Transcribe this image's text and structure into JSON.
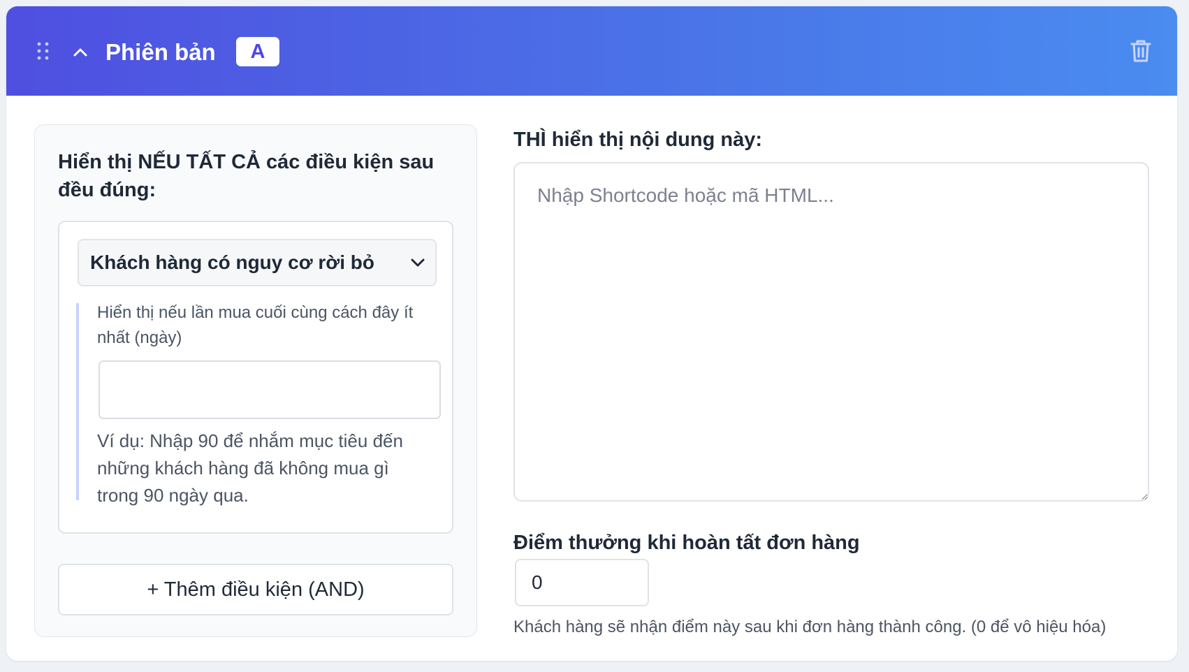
{
  "header": {
    "title": "Phiên bản",
    "badge": "A",
    "colors": {
      "gradient_start": "#4f4fe0",
      "gradient_end": "#4a8cf0"
    },
    "icons": [
      "drag-handle-icon",
      "chevron-up-icon",
      "trash-icon"
    ]
  },
  "conditions": {
    "title": "Hiển thị NẾU TẤT CẢ các điều kiện sau đều đúng:",
    "selected_condition": "Khách hàng có nguy cơ rời bỏ",
    "days_label": "Hiển thị nếu lần mua cuối cùng cách đây ít nhất (ngày)",
    "days_value": "",
    "days_help": "Ví dụ: Nhập 90 để nhắm mục tiêu đến những khách hàng đã không mua gì trong 90 ngày qua.",
    "add_button": "+ Thêm điều kiện (AND)"
  },
  "content": {
    "label": "THÌ hiển thị nội dung này:",
    "placeholder": "Nhập Shortcode hoặc mã HTML..."
  },
  "points": {
    "label": "Điểm thưởng khi hoàn tất đơn hàng",
    "value": "0",
    "help": "Khách hàng sẽ nhận điểm này sau khi đơn hàng thành công. (0 để vô hiệu hóa)"
  }
}
